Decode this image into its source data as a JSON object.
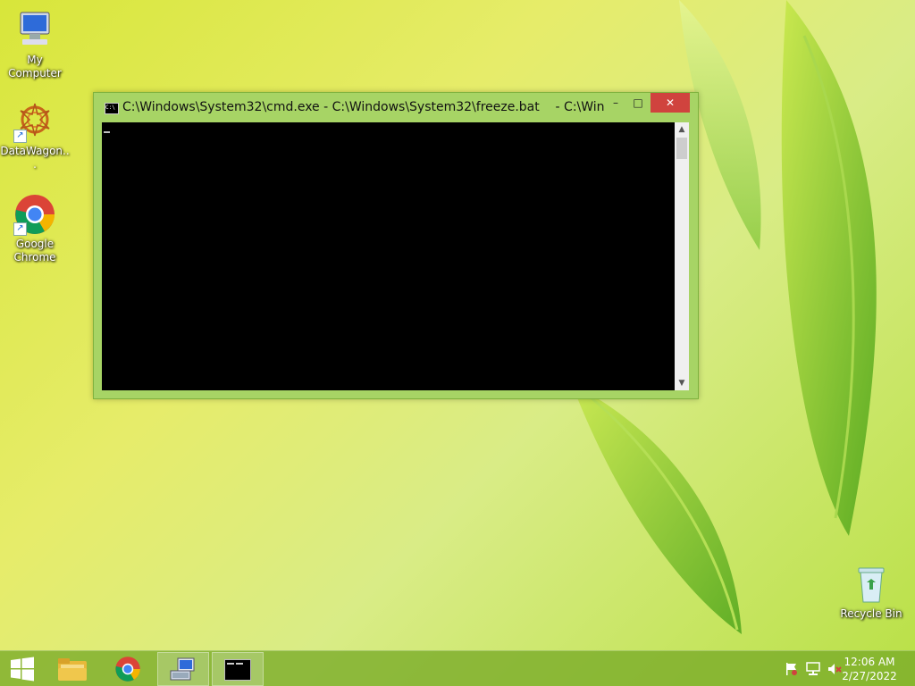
{
  "desktop": {
    "icons": [
      {
        "label": "My Computer",
        "icon": "computer-icon"
      },
      {
        "label": "DataWagon...",
        "icon": "datawagon-icon"
      },
      {
        "label": "Google Chrome",
        "icon": "chrome-icon"
      },
      {
        "label": "Recycle Bin",
        "icon": "recycle-bin-icon"
      }
    ]
  },
  "window": {
    "title": "C:\\Windows\\System32\\cmd.exe - C:\\Windows\\System32\\freeze.bat    - C:\\Wind...",
    "min_glyph": "–",
    "max_glyph": "□",
    "close_glyph": "✕",
    "scroll_up_glyph": "▲",
    "scroll_down_glyph": "▼"
  },
  "taskbar": {
    "buttons": [
      {
        "name": "start",
        "icon": "windows-logo-icon"
      },
      {
        "name": "file-explorer",
        "icon": "folder-icon"
      },
      {
        "name": "chrome",
        "icon": "chrome-icon"
      },
      {
        "name": "network",
        "icon": "network-computer-icon",
        "active": true
      },
      {
        "name": "cmd",
        "icon": "cmd-icon",
        "active": true
      }
    ],
    "tray": {
      "icons": [
        "flag-icon",
        "network-icon",
        "speaker-muted-icon"
      ],
      "time": "12:06 AM",
      "date": "2/27/2022"
    }
  },
  "colors": {
    "window_frame": "#a7d465",
    "close_button": "#d0433e",
    "console_bg": "#000000",
    "taskbar": "#78aa28"
  }
}
